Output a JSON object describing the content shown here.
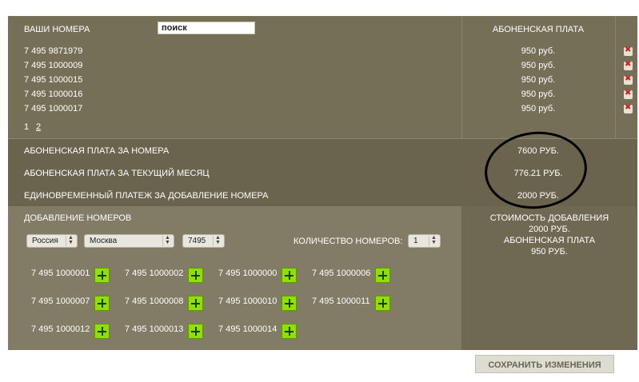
{
  "numbers_section": {
    "title": "ВАШИ НОМЕРА",
    "search_value": "поиск",
    "fee_header": "АБОНЕНСКАЯ ПЛАТА",
    "rows": [
      {
        "number": "7 495 9871979",
        "fee": "950 руб."
      },
      {
        "number": "7 495 1000009",
        "fee": "950 руб."
      },
      {
        "number": "7 495 1000015",
        "fee": "950 руб."
      },
      {
        "number": "7 495 1000016",
        "fee": "950 руб."
      },
      {
        "number": "7 495 1000017",
        "fee": "950 руб."
      }
    ],
    "pages": [
      "1",
      "2"
    ]
  },
  "summary": {
    "rows": [
      {
        "label": "АБОНЕНСКАЯ ПЛАТА ЗА НОМЕРА",
        "value": "7600 РУБ."
      },
      {
        "label": "АБОНЕНСКАЯ ПЛАТА ЗА ТЕКУЩИЙ МЕСЯЦ",
        "value": "776.21 РУБ."
      },
      {
        "label": "ЕДИНОВРЕМЕННЫЙ ПЛАТЕЖ ЗА ДОБАВЛЕНИЕ НОМЕРА",
        "value": "2000 РУБ."
      }
    ]
  },
  "add_section": {
    "title": "ДОБАВЛЕНИЕ НОМЕРОВ",
    "country": "Россия",
    "city": "Москва",
    "code": "7495",
    "count_label": "КОЛИЧЕСТВО НОМЕРОВ:",
    "count_value": "1",
    "candidates": [
      [
        "7 495 1000001",
        "7 495 1000002",
        "7 495 1000000",
        "7 495 1000006"
      ],
      [
        "7 495 1000007",
        "7 495 1000008",
        "7 495 1000010",
        "7 495 1000011"
      ],
      [
        "7 495 1000012",
        "7 495 1000013",
        "7 495 1000014"
      ]
    ],
    "cost_label": "СТОИМОСТЬ ДОБАВЛЕНИЯ",
    "cost_value": "2000 РУБ.",
    "fee_label": "АБОНЕНСКАЯ ПЛАТА",
    "fee_value": "950 РУБ."
  },
  "footer": {
    "save_label": "СОХРАНИТЬ ИЗМЕНЕНИЯ"
  }
}
